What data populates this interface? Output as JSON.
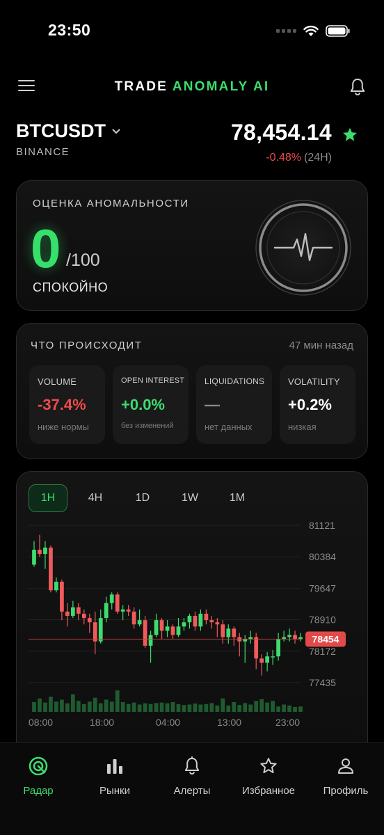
{
  "status_bar": {
    "time": "23:50"
  },
  "header": {
    "title_part1": "TRADE ",
    "title_part2": "ANOMALY AI"
  },
  "symbol": {
    "name": "BTCUSDT",
    "exchange": "BINANCE",
    "price": "78,454.14",
    "change": "-0.48%",
    "change_period": "(24H)"
  },
  "score": {
    "title": "ОЦЕНКА АНОМАЛЬНОСТИ",
    "value": "0",
    "max": "/100",
    "status": "СПОКОЙНО"
  },
  "happening": {
    "title": "ЧТО ПРОИСХОДИТ",
    "time_ago": "47 мин назад",
    "metrics": [
      {
        "label": "VOLUME",
        "value": "-37.4%",
        "sub": "ниже нормы",
        "color": "#ef4b4b"
      },
      {
        "label": "OPEN INTEREST",
        "value": "+0.0%",
        "sub": "без изменений",
        "color": "#3ddc6e"
      },
      {
        "label": "LIQUIDATIONS",
        "value": "—",
        "sub": "нет данных",
        "color": "#8a8a8a"
      },
      {
        "label": "VOLATILITY",
        "value": "+0.2%",
        "sub": "низкая",
        "color": "#ffffff"
      }
    ]
  },
  "chart": {
    "timeframes": [
      "1H",
      "4H",
      "1D",
      "1W",
      "1M"
    ],
    "active_timeframe": "1H"
  },
  "chart_data": {
    "type": "candlestick",
    "y_ticks": [
      "81121",
      "80384",
      "79647",
      "78910",
      "78172",
      "77435"
    ],
    "ylim": [
      77435,
      81121
    ],
    "x_ticks": [
      "08:00",
      "18:00",
      "04:00",
      "13:00",
      "23:00"
    ],
    "current_price_label": "78454",
    "current_price": 78454,
    "colors": {
      "up": "#3ddc6e",
      "down": "#ef5a5a",
      "price_line": "#c94040"
    },
    "candles": [
      [
        80200,
        80550,
        80750,
        80150
      ],
      [
        80550,
        80450,
        80900,
        80380
      ],
      [
        80450,
        80600,
        80750,
        80100
      ],
      [
        80600,
        79600,
        80650,
        79550
      ],
      [
        79600,
        79800,
        79900,
        79550
      ],
      [
        79800,
        79100,
        79850,
        78900
      ],
      [
        79100,
        79000,
        79300,
        78750
      ],
      [
        79000,
        79200,
        79350,
        78950
      ],
      [
        79200,
        79050,
        79300,
        78900
      ],
      [
        79050,
        78950,
        79150,
        78800
      ],
      [
        78950,
        78850,
        79050,
        78600
      ],
      [
        78850,
        78400,
        79100,
        78100
      ],
      [
        78400,
        78950,
        79150,
        78350
      ],
      [
        78950,
        79300,
        79450,
        78850
      ],
      [
        79300,
        79500,
        79550,
        79150
      ],
      [
        79500,
        79100,
        79550,
        79050
      ],
      [
        79100,
        79150,
        79250,
        78900
      ],
      [
        79150,
        79100,
        79250,
        79000
      ],
      [
        79100,
        78800,
        79200,
        78700
      ],
      [
        78800,
        78900,
        79150,
        78750
      ],
      [
        78900,
        78300,
        79000,
        78250
      ],
      [
        78300,
        78550,
        78650,
        77900
      ],
      [
        78550,
        78900,
        79050,
        78500
      ],
      [
        78900,
        78650,
        78950,
        78450
      ],
      [
        78650,
        78750,
        78900,
        78500
      ],
      [
        78750,
        78550,
        78800,
        78450
      ],
      [
        78550,
        78750,
        78950,
        78500
      ],
      [
        78750,
        78850,
        78950,
        78650
      ],
      [
        78850,
        79000,
        79050,
        78700
      ],
      [
        79000,
        78750,
        79100,
        78650
      ],
      [
        78750,
        79050,
        79150,
        78650
      ],
      [
        79050,
        78900,
        79150,
        78800
      ],
      [
        78900,
        78850,
        79000,
        78700
      ],
      [
        78850,
        78800,
        78950,
        78500
      ],
      [
        78800,
        78500,
        78900,
        78350
      ],
      [
        78500,
        78700,
        78800,
        78350
      ],
      [
        78700,
        78500,
        78750,
        78300
      ],
      [
        78500,
        78400,
        78600,
        78050
      ],
      [
        78400,
        78450,
        78550,
        77900
      ],
      [
        78450,
        78500,
        78650,
        78350
      ],
      [
        78500,
        78000,
        78600,
        77750
      ],
      [
        78000,
        77900,
        78100,
        77600
      ],
      [
        77900,
        78050,
        78150,
        77700
      ],
      [
        78050,
        78050,
        78200,
        77850
      ],
      [
        78050,
        78450,
        78600,
        77950
      ],
      [
        78450,
        78500,
        78650,
        78400
      ],
      [
        78500,
        78550,
        78700,
        78400
      ],
      [
        78550,
        78450,
        78650,
        78350
      ],
      [
        78450,
        78500,
        78600,
        78400
      ]
    ],
    "volumes": [
      0.4,
      0.55,
      0.38,
      0.62,
      0.42,
      0.5,
      0.35,
      0.72,
      0.45,
      0.32,
      0.42,
      0.58,
      0.35,
      0.5,
      0.42,
      0.88,
      0.4,
      0.32,
      0.38,
      0.3,
      0.35,
      0.32,
      0.36,
      0.38,
      0.35,
      0.4,
      0.32,
      0.28,
      0.3,
      0.34,
      0.3,
      0.32,
      0.36,
      0.26,
      0.55,
      0.26,
      0.4,
      0.28,
      0.36,
      0.3,
      0.45,
      0.52,
      0.38,
      0.45,
      0.22,
      0.3,
      0.26,
      0.2,
      0.22
    ],
    "volumes_unit": "relative"
  },
  "tabs": [
    {
      "label": "Радар",
      "icon": "radar-icon"
    },
    {
      "label": "Рынки",
      "icon": "bar-chart-icon"
    },
    {
      "label": "Алерты",
      "icon": "bell-icon"
    },
    {
      "label": "Избранное",
      "icon": "star-icon"
    },
    {
      "label": "Профиль",
      "icon": "user-icon"
    }
  ],
  "accent_color": "#3ddc6e"
}
